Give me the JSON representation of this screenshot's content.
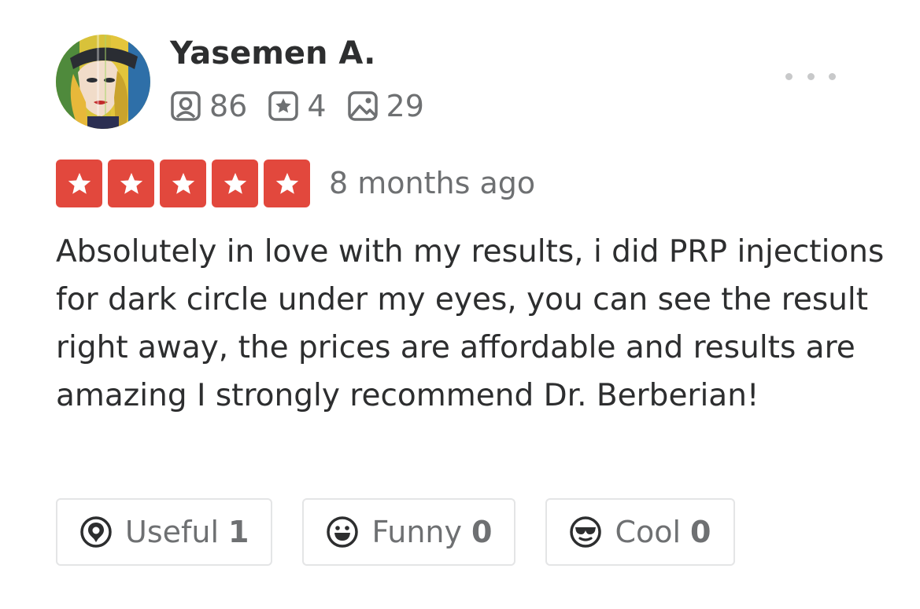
{
  "reviewer": {
    "name": "Yasemen A.",
    "stats": {
      "friends": "86",
      "reviews": "4",
      "photos": "29"
    }
  },
  "review": {
    "rating": 5,
    "rating_max": 5,
    "date": "8 months ago",
    "text": "Absolutely in love with my results, i did PRP injections for dark circle under my eyes, you can see the result right away, the prices are affordable and results are amazing I strongly recommend Dr. Berberian!"
  },
  "reactions": {
    "useful": {
      "label": "Useful",
      "count": "1"
    },
    "funny": {
      "label": "Funny",
      "count": "0"
    },
    "cool": {
      "label": "Cool",
      "count": "0"
    }
  },
  "icons": {
    "more": "more-dots-icon",
    "friends": "friends-icon",
    "reviews": "review-star-icon",
    "photos": "photo-icon",
    "star": "star-icon",
    "useful": "useful-icon",
    "funny": "funny-face-icon",
    "cool": "cool-sunglasses-icon"
  },
  "colors": {
    "star_background": "#e2483d",
    "text_primary": "#2d2e2f",
    "text_secondary": "#6e7072",
    "border": "#e4e5e6"
  }
}
